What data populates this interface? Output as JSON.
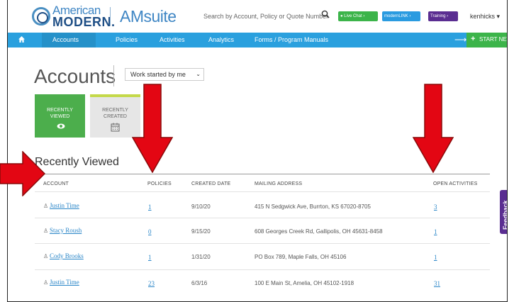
{
  "header": {
    "logo_line1": "American",
    "logo_line2": "MODERN.",
    "app_name": "AMsuite",
    "search_placeholder": "Search by Account, Policy or Quote Number",
    "live_chat": "Live Chat",
    "modernlink": "modernLINK",
    "training": "Training",
    "user": "kenhicks"
  },
  "nav": {
    "items": [
      "Accounts",
      "Policies",
      "Activities",
      "Analytics",
      "Forms / Program Manuals"
    ],
    "start_quote": "START NEW QUOTE"
  },
  "page": {
    "title": "Accounts",
    "filter_value": "Work started by me",
    "tiles": [
      {
        "line1": "RECENTLY",
        "line2": "VIEWED"
      },
      {
        "line1": "RECENTLY",
        "line2": "CREATED"
      }
    ],
    "section_title": "Recently Viewed"
  },
  "table": {
    "columns": [
      "ACCOUNT",
      "POLICIES",
      "CREATED DATE",
      "MAILING ADDRESS",
      "OPEN ACTIVITIES"
    ],
    "rows": [
      {
        "account": "Justin Time",
        "policies": "1",
        "created": "9/10/20",
        "address": "415 N Sedgwick Ave, Burrton, KS 67020-8705",
        "activities": "3"
      },
      {
        "account": "Stacy Roush",
        "policies": "0",
        "created": "9/15/20",
        "address": "608 Georges Creek Rd, Gallipolis, OH 45631-8458",
        "activities": "1"
      },
      {
        "account": "Cody Brooks",
        "policies": "1",
        "created": "1/31/20",
        "address": "PO Box 789, Maple Falls, OH 45106",
        "activities": "1"
      },
      {
        "account": "Justin Time",
        "policies": "23",
        "created": "6/3/16",
        "address": "100 E Main St, Amelia, OH 45102-1918",
        "activities": "31"
      }
    ]
  },
  "feedback": "Feedback",
  "colors": {
    "nav": "#2aa0de",
    "green": "#4cae4c",
    "link": "#2a86c8",
    "annotation_arrow": "#e30613"
  }
}
